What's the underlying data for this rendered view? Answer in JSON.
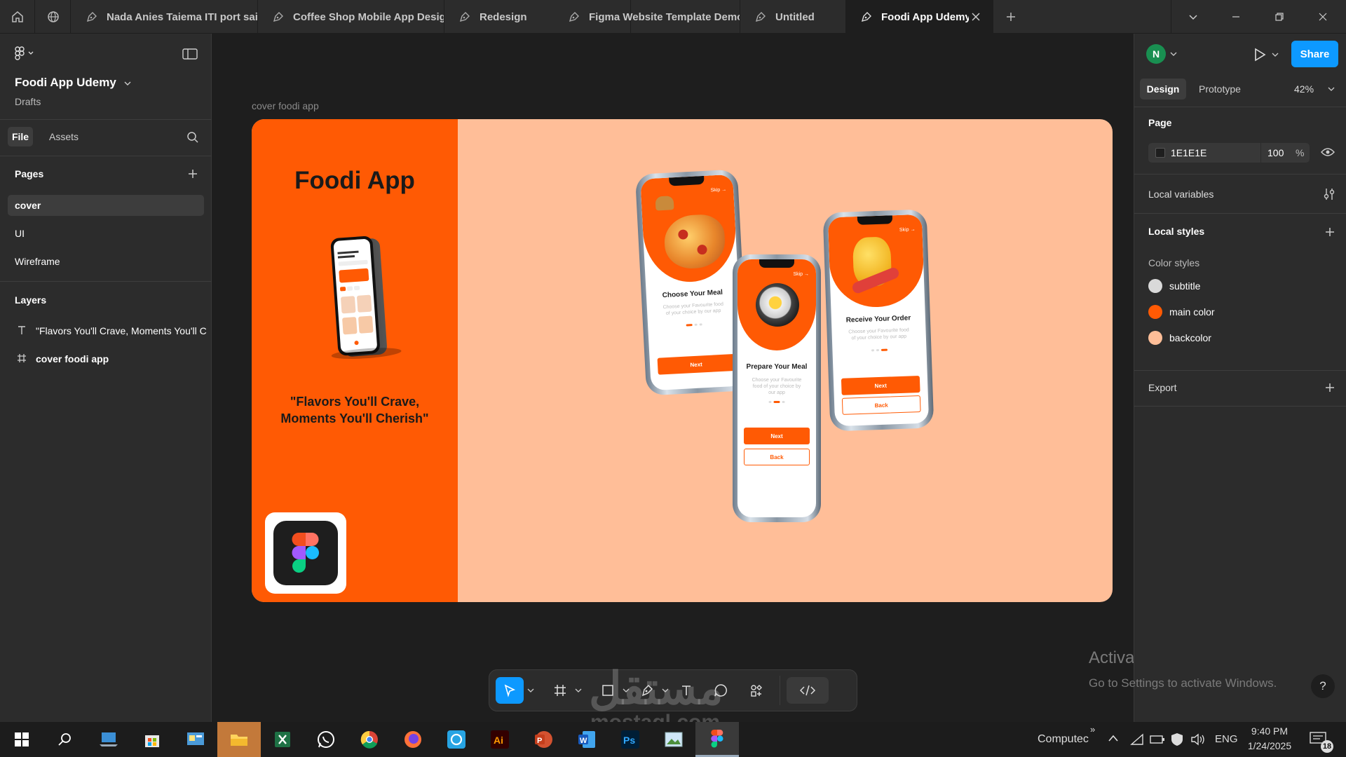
{
  "tabs": [
    {
      "label": "Nada Anies Taiema ITI port saic"
    },
    {
      "label": "Coffee Shop Mobile App Design"
    },
    {
      "label": "Redesign"
    },
    {
      "label": "Figma Website Template Demo"
    },
    {
      "label": "Untitled"
    },
    {
      "label": "Foodi App Udemy"
    }
  ],
  "left_panel": {
    "file_name": "Foodi App Udemy",
    "location": "Drafts",
    "tab_file": "File",
    "tab_assets": "Assets",
    "pages_heading": "Pages",
    "pages": [
      "cover",
      "UI",
      "Wireframe"
    ],
    "layers_heading": "Layers",
    "layers": [
      {
        "label": "\"Flavors You'll Crave, Moments You'll C",
        "icon": "text-icon"
      },
      {
        "label": "cover foodi app",
        "icon": "frame-icon"
      }
    ]
  },
  "canvas": {
    "frame_label": "cover foodi app",
    "cover_title": "Foodi App",
    "tagline_line1": "\"Flavors You'll Crave,",
    "tagline_line2": "Moments You'll Cherish\"",
    "phones": [
      {
        "skip": "Skip →",
        "title": "Choose Your Meal",
        "text": "Choose your Favourite food of your choice by our app",
        "next": "Next"
      },
      {
        "skip": "Skip →",
        "title": "Prepare Your Meal",
        "text": "Choose your Favourite food of your choice by our app",
        "next": "Next",
        "back": "Back"
      },
      {
        "skip": "Skip →",
        "title": "Receive Your Order",
        "text": "Choose your Favourite food of your choice by our app",
        "next": "Next",
        "back": "Back"
      }
    ],
    "watermark_title": "Activate Windows",
    "watermark_sub": "Go to Settings to activate Windows.",
    "site_watermark_1": "مستقل",
    "site_watermark_2": "mostaql.com"
  },
  "right_panel": {
    "avatar_initial": "N",
    "share": "Share",
    "tab_design": "Design",
    "tab_prototype": "Prototype",
    "zoom": "42%",
    "page_heading": "Page",
    "page_color": "1E1E1E",
    "page_opacity": "100",
    "percent": "%",
    "local_variables": "Local variables",
    "local_styles": "Local styles",
    "color_styles": "Color styles",
    "styles": [
      {
        "name": "subtitle",
        "color": "#d9d9d9"
      },
      {
        "name": "main color",
        "color": "#ff5a04"
      },
      {
        "name": "backcolor",
        "color": "#ffbe98"
      }
    ],
    "export": "Export",
    "help": "?"
  },
  "taskbar": {
    "label": "Computec",
    "lang": "ENG",
    "time": "9:40 PM",
    "date": "1/24/2025",
    "notif_count": "18"
  },
  "colors": {
    "accent": "#0d99ff",
    "orange": "#ff5a04",
    "peach": "#ffbe98"
  }
}
